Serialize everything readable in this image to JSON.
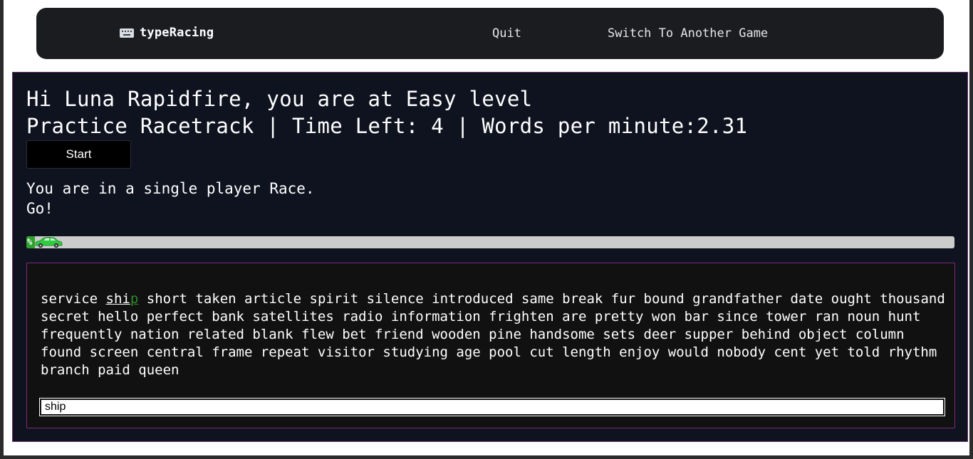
{
  "nav": {
    "brand": "typeRacing",
    "quit": "Quit",
    "switch_game": "Switch To Another Game"
  },
  "game": {
    "greeting": "Hi Luna Rapidfire, you are at Easy level",
    "track_line": "Practice Racetrack | Time Left: 4 | Words per minute:2.31",
    "start_label": "Start",
    "status_mode": "You are in a single player Race.",
    "status_go": "Go!",
    "progress_label": "%",
    "progress_fraction": 0.0,
    "colors": {
      "panel_bg": "#0f1320",
      "panel_border": "#6a2d6e",
      "progress_fill": "#2ea12e",
      "car_color": "#2ecc40",
      "current_word_remaining": "#2e8b2e"
    }
  },
  "passage": {
    "before_current": "service",
    "current_typed": "shi",
    "current_remaining": "p",
    "after_current": "short taken article spirit silence introduced same break fur bound grandfather date ought thousand secret hello perfect bank satellites radio information frighten are pretty won bar since tower ran noun hunt frequently nation related blank flew bet friend wooden pine handsome sets deer supper behind object column found screen central frame repeat visitor studying age pool cut length enjoy would nobody cent yet told rhythm branch paid queen"
  },
  "input": {
    "value": "ship"
  }
}
